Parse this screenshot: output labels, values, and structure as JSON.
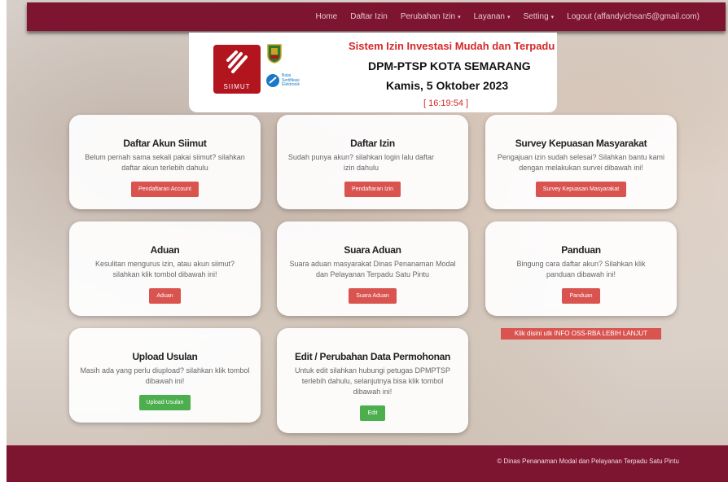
{
  "nav": {
    "items": [
      {
        "label": "Home",
        "dropdown": false
      },
      {
        "label": "Daftar Izin",
        "dropdown": false
      },
      {
        "label": "Perubahan Izin",
        "dropdown": true
      },
      {
        "label": "Layanan",
        "dropdown": true
      },
      {
        "label": "Setting",
        "dropdown": true
      },
      {
        "label": "Logout (affandyichsan5@gmail.com)",
        "dropdown": false
      }
    ],
    "caret": "▾",
    "color": "#7d1430"
  },
  "header": {
    "title": "Sistem Izin Investasi Mudah dan Terpadu",
    "org": "DPM-PTSP KOTA SEMARANG",
    "date": "Kamis, 5 Oktober 2023",
    "time": "[ 16:19:54 ]",
    "logo_text": "SIIMUT",
    "bsre_text": [
      "Balai",
      "Sertifikasi",
      "Elektronik"
    ]
  },
  "cards": [
    {
      "title": "Daftar Akun Siimut",
      "desc": "Belum pernah sama sekali pakai siimut? silahkan daftar akun terlebih dahulu",
      "button": "Pendaftaran Account",
      "color": "red"
    },
    {
      "title": "Daftar Izin",
      "desc": "Sudah punya akun? silahkan login lalu daftar izin dahulu",
      "button": "Pendaftaran Izin",
      "color": "red"
    },
    {
      "title": "Survey Kepuasan Masyarakat",
      "desc": "Pengajuan izin sudah selesai? Silahkan bantu kami dengan melakukan survei dibawah ini!",
      "button": "Survey Kepuasan Masyarakat",
      "color": "red"
    },
    {
      "title": "Aduan",
      "desc": "Kesulitan mengurus izin, atau akun siimut? silahkan klik tombol dibawah ini!",
      "button": "Aduan",
      "color": "red"
    },
    {
      "title": "Suara Aduan",
      "desc": "Suara aduan masyarakat Dinas Penanaman Modal dan Pelayanan Terpadu Satu Pintu",
      "button": "Suara Aduan",
      "color": "red"
    },
    {
      "title": "Panduan",
      "desc": "Bingung cara daftar akun? Silahkan klik panduan dibawah ini!",
      "button": "Panduan",
      "color": "red"
    },
    {
      "title": "Upload Usulan",
      "desc": "Masih ada yang perlu diupload? silahkan klik tombol dibawah ini!",
      "button": "Upload Usulan",
      "color": "green"
    },
    {
      "title": "Edit / Perubahan Data Permohonan",
      "desc": "Untuk edit silahkan hubungi petugas DPMPTSP terlebih dahulu, selanjutnya bisa klik tombol dibawah ini!",
      "button": "Edit",
      "color": "green"
    }
  ],
  "oss_link": "Klik disini utk INFO OSS-RBA LEBIH LANJUT",
  "footer": "© Dinas Penanaman Modal dan Pelayanan Terpadu Satu Pintu"
}
